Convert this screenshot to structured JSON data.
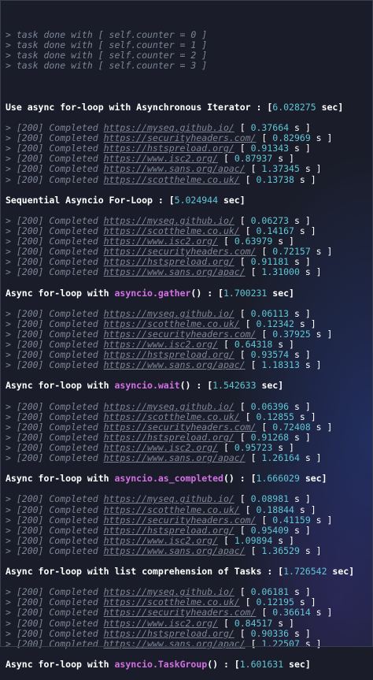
{
  "task_lines": [
    "> task done with [ self.counter = 0 ]",
    "> task done with [ self.counter = 1 ]",
    "> task done with [ self.counter = 2 ]",
    "> task done with [ self.counter = 3 ]"
  ],
  "sections": [
    {
      "heading_prefix": "Use async for-loop with Asynchronous Iterator : [",
      "heading_fn": "",
      "heading_suffix": "",
      "time": "6.028275",
      "unit": " sec]",
      "results": [
        {
          "prefix": "> [200] Completed ",
          "url": "https://myseq.github.io/",
          "open": " [ ",
          "time": "0.37664",
          "close": " s ]"
        },
        {
          "prefix": "> [200] Completed ",
          "url": "https://securityheaders.com/",
          "open": " [ ",
          "time": "0.82969",
          "close": " s ]"
        },
        {
          "prefix": "> [200] Completed ",
          "url": "https://hstspreload.org/",
          "open": " [ ",
          "time": "0.91343",
          "close": " s ]"
        },
        {
          "prefix": "> [200] Completed ",
          "url": "https://www.isc2.org/",
          "open": " [ ",
          "time": "0.87937",
          "close": " s ]"
        },
        {
          "prefix": "> [200] Completed ",
          "url": "https://www.sans.org/apac/",
          "open": " [ ",
          "time": "1.37345",
          "close": " s ]"
        },
        {
          "prefix": "> [200] Completed ",
          "url": "https://scotthelme.co.uk/",
          "open": " [ ",
          "time": "0.13738",
          "close": " s ]"
        }
      ]
    },
    {
      "heading_prefix": "Sequential Asyncio For-Loop : [",
      "heading_fn": "",
      "heading_suffix": "",
      "time": "5.024944",
      "unit": " sec]",
      "results": [
        {
          "prefix": "> [200] Completed ",
          "url": "https://myseq.github.io/",
          "open": " [ ",
          "time": "0.06273",
          "close": " s ]"
        },
        {
          "prefix": "> [200] Completed ",
          "url": "https://scotthelme.co.uk/",
          "open": " [ ",
          "time": "0.14167",
          "close": " s ]"
        },
        {
          "prefix": "> [200] Completed ",
          "url": "https://www.isc2.org/",
          "open": " [ ",
          "time": "0.63979",
          "close": " s ]"
        },
        {
          "prefix": "> [200] Completed ",
          "url": "https://securityheaders.com/",
          "open": " [ ",
          "time": "0.72157",
          "close": " s ]"
        },
        {
          "prefix": "> [200] Completed ",
          "url": "https://hstspreload.org/",
          "open": " [ ",
          "time": "0.91181",
          "close": " s ]"
        },
        {
          "prefix": "> [200] Completed ",
          "url": "https://www.sans.org/apac/",
          "open": " [ ",
          "time": "1.31000",
          "close": " s ]"
        }
      ]
    },
    {
      "heading_prefix": "Async for-loop with ",
      "heading_fn": "asyncio.gather",
      "heading_suffix": "() : [",
      "time": "1.700231",
      "unit": " sec]",
      "results": [
        {
          "prefix": "> [200] Completed ",
          "url": "https://myseq.github.io/",
          "open": " [ ",
          "time": "0.06113",
          "close": " s ]"
        },
        {
          "prefix": "> [200] Completed ",
          "url": "https://scotthelme.co.uk/",
          "open": " [ ",
          "time": "0.12342",
          "close": " s ]"
        },
        {
          "prefix": "> [200] Completed ",
          "url": "https://securityheaders.com/",
          "open": " [ ",
          "time": "0.37925",
          "close": " s ]"
        },
        {
          "prefix": "> [200] Completed ",
          "url": "https://www.isc2.org/",
          "open": " [ ",
          "time": "0.64318",
          "close": " s ]"
        },
        {
          "prefix": "> [200] Completed ",
          "url": "https://hstspreload.org/",
          "open": " [ ",
          "time": "0.93574",
          "close": " s ]"
        },
        {
          "prefix": "> [200] Completed ",
          "url": "https://www.sans.org/apac/",
          "open": " [ ",
          "time": "1.18313",
          "close": " s ]"
        }
      ]
    },
    {
      "heading_prefix": "Async for-loop with ",
      "heading_fn": "asyncio.wait",
      "heading_suffix": "() : [",
      "time": "1.542633",
      "unit": " sec]",
      "results": [
        {
          "prefix": "> [200] Completed ",
          "url": "https://myseq.github.io/",
          "open": " [ ",
          "time": "0.06396",
          "close": " s ]"
        },
        {
          "prefix": "> [200] Completed ",
          "url": "https://scotthelme.co.uk/",
          "open": " [ ",
          "time": "0.12855",
          "close": " s ]"
        },
        {
          "prefix": "> [200] Completed ",
          "url": "https://securityheaders.com/",
          "open": " [ ",
          "time": "0.72408",
          "close": " s ]"
        },
        {
          "prefix": "> [200] Completed ",
          "url": "https://hstspreload.org/",
          "open": " [ ",
          "time": "0.91268",
          "close": " s ]"
        },
        {
          "prefix": "> [200] Completed ",
          "url": "https://www.isc2.org/",
          "open": " [ ",
          "time": "0.95723",
          "close": " s ]"
        },
        {
          "prefix": "> [200] Completed ",
          "url": "https://www.sans.org/apac/",
          "open": " [ ",
          "time": "1.26164",
          "close": " s ]"
        }
      ]
    },
    {
      "heading_prefix": "Async for-loop with ",
      "heading_fn": "asyncio.as_completed",
      "heading_suffix": "() : [",
      "time": "1.666029",
      "unit": " sec]",
      "results": [
        {
          "prefix": "> [200] Completed ",
          "url": "https://myseq.github.io/",
          "open": " [ ",
          "time": "0.08981",
          "close": " s ]"
        },
        {
          "prefix": "> [200] Completed ",
          "url": "https://scotthelme.co.uk/",
          "open": " [ ",
          "time": "0.18844",
          "close": " s ]"
        },
        {
          "prefix": "> [200] Completed ",
          "url": "https://securityheaders.com/",
          "open": " [ ",
          "time": "0.41159",
          "close": " s ]"
        },
        {
          "prefix": "> [200] Completed ",
          "url": "https://hstspreload.org/",
          "open": " [ ",
          "time": "0.95409",
          "close": " s ]"
        },
        {
          "prefix": "> [200] Completed ",
          "url": "https://www.isc2.org/",
          "open": " [ ",
          "time": "1.09894",
          "close": " s ]"
        },
        {
          "prefix": "> [200] Completed ",
          "url": "https://www.sans.org/apac/",
          "open": " [ ",
          "time": "1.36529",
          "close": " s ]"
        }
      ]
    },
    {
      "heading_prefix": "Async for-loop with list comprehension of Tasks : [",
      "heading_fn": "",
      "heading_suffix": "",
      "time": "1.726542",
      "unit": " sec]",
      "results": [
        {
          "prefix": "> [200] Completed ",
          "url": "https://myseq.github.io/",
          "open": " [ ",
          "time": "0.06181",
          "close": " s ]"
        },
        {
          "prefix": "> [200] Completed ",
          "url": "https://scotthelme.co.uk/",
          "open": " [ ",
          "time": "0.12195",
          "close": " s ]"
        },
        {
          "prefix": "> [200] Completed ",
          "url": "https://securityheaders.com/",
          "open": " [ ",
          "time": "0.36614",
          "close": " s ]"
        },
        {
          "prefix": "> [200] Completed ",
          "url": "https://www.isc2.org/",
          "open": " [ ",
          "time": "0.84517",
          "close": " s ]"
        },
        {
          "prefix": "> [200] Completed ",
          "url": "https://hstspreload.org/",
          "open": " [ ",
          "time": "0.90336",
          "close": " s ]"
        },
        {
          "prefix": "> [200] Completed ",
          "url": "https://www.sans.org/apac/",
          "open": " [ ",
          "time": "1.22507",
          "close": " s ]"
        }
      ]
    },
    {
      "heading_prefix": "Async for-loop with ",
      "heading_fn": "asyncio.TaskGroup",
      "heading_suffix": "() : [",
      "time": "1.601631",
      "unit": " sec]",
      "results": []
    }
  ],
  "colors": {
    "background": "#1a1d29",
    "dim_text": "#7c8496",
    "heading_text": "#ffffff",
    "function_name": "#d46fe5",
    "time_value": "#60c6d6"
  }
}
